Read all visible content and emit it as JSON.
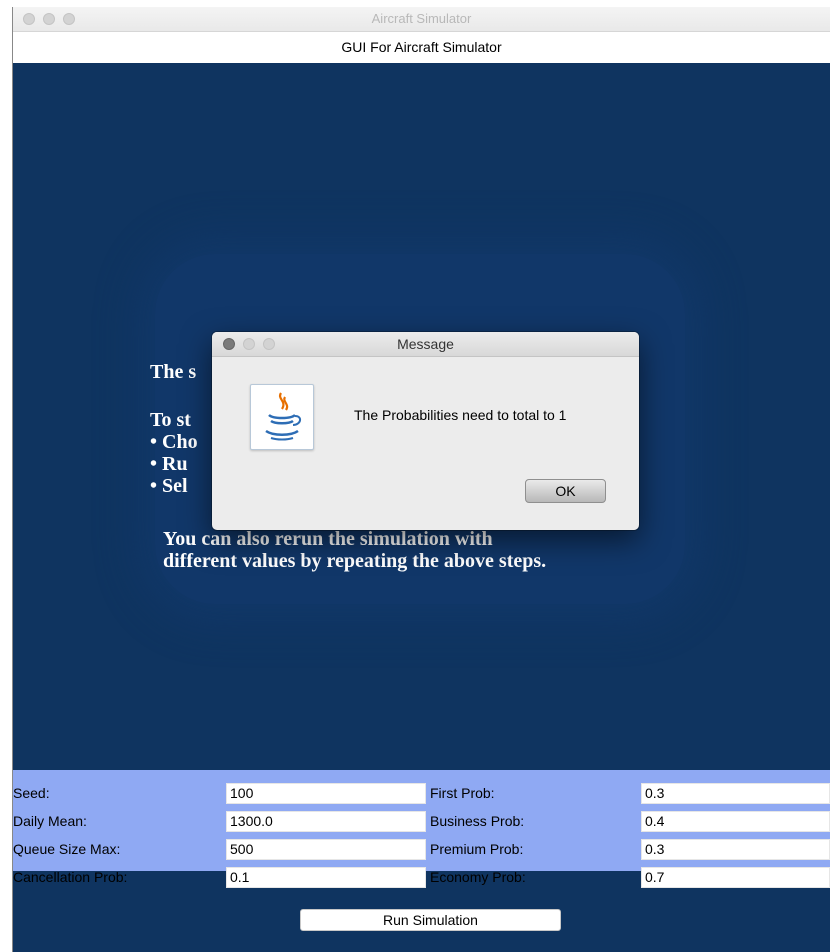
{
  "window": {
    "title": "Aircraft Simulator",
    "header": "GUI For Aircraft Simulator"
  },
  "info": {
    "line1": "The s",
    "line2": "To st",
    "line3": "• Cho",
    "line4": "• Ru",
    "line5": "• Sel",
    "line6": "You can also rerun the simulation with",
    "line7": "different values by repeating the above steps."
  },
  "dialog": {
    "title": "Message",
    "message": "The Probabilities need to total to 1",
    "ok_label": "OK"
  },
  "params": {
    "seed_label": "Seed:",
    "seed_value": "100",
    "daily_mean_label": "Daily Mean:",
    "daily_mean_value": "1300.0",
    "queue_size_label": "Queue Size Max:",
    "queue_size_value": "500",
    "cancellation_label": "Cancellation Prob:",
    "cancellation_value": "0.1",
    "first_label": "First Prob:",
    "first_value": "0.3",
    "business_label": "Business Prob:",
    "business_value": "0.4",
    "premium_label": "Premium Prob:",
    "premium_value": "0.3",
    "economy_label": "Economy Prob:",
    "economy_value": "0.7"
  },
  "run_button": "Run Simulation",
  "colors": {
    "background": "#0f3460",
    "param_panel": "#8fa9f3"
  }
}
